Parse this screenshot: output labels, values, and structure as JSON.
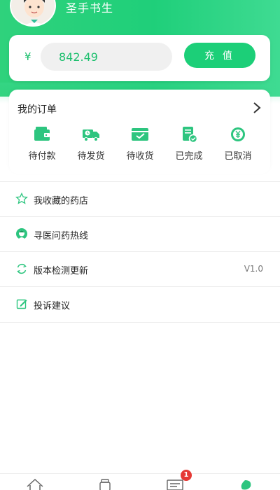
{
  "header": {
    "username": "圣手书生"
  },
  "balance": {
    "currency_symbol": "¥",
    "amount": "842.49",
    "recharge_label": "充 值"
  },
  "orders": {
    "title": "我的订单",
    "items": [
      {
        "label": "待付款",
        "icon": "wallet-icon"
      },
      {
        "label": "待发货",
        "icon": "delivery-truck-icon"
      },
      {
        "label": "待收货",
        "icon": "package-receive-icon"
      },
      {
        "label": "已完成",
        "icon": "completed-document-icon"
      },
      {
        "label": "已取消",
        "icon": "cancelled-yen-icon"
      }
    ]
  },
  "menu": {
    "items": [
      {
        "label": "我收藏的药店",
        "icon": "star-icon"
      },
      {
        "label": "寻医问药热线",
        "icon": "doctor-icon"
      },
      {
        "label": "版本检测更新",
        "icon": "refresh-icon",
        "value": "V1.0"
      },
      {
        "label": "投诉建议",
        "icon": "edit-icon"
      }
    ]
  },
  "tabbar": {
    "badge_count": "1"
  },
  "colors": {
    "accent": "#1ccf78",
    "header_green": "#2fd27c",
    "badge_red": "#e53935"
  }
}
